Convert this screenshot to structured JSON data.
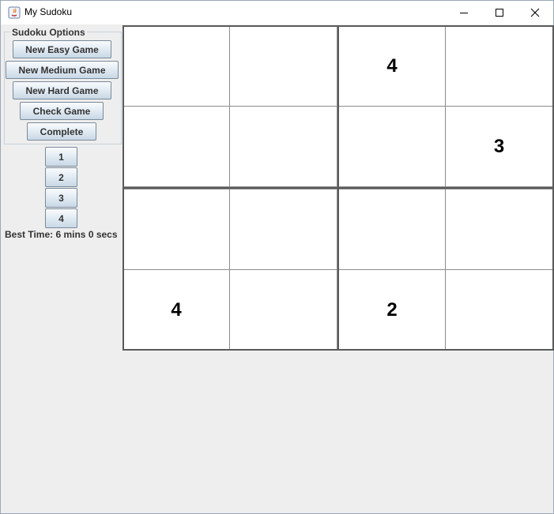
{
  "window": {
    "title": "My Sudoku"
  },
  "options": {
    "legend": "Sudoku Options",
    "buttons": [
      "New Easy Game",
      "New Medium Game",
      "New Hard Game",
      "Check Game",
      "Complete"
    ]
  },
  "number_buttons": [
    "1",
    "2",
    "3",
    "4"
  ],
  "best_time": "Best Time: 6 mins 0 secs",
  "board": {
    "rows": [
      [
        "",
        "",
        "4",
        ""
      ],
      [
        "",
        "",
        "",
        "3"
      ],
      [
        "",
        "",
        "",
        ""
      ],
      [
        "4",
        "",
        "2",
        ""
      ]
    ]
  }
}
